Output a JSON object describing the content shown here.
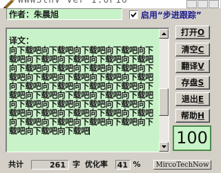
{
  "window": {
    "title": "WWWSlnV Ver 1.0F16",
    "app_icon": "pencil-cursor-icon"
  },
  "author": {
    "text": "作者：朱晨旭"
  },
  "step_trace": {
    "label": "启用“步进跟踪”",
    "checked": true
  },
  "content": {
    "heading": "译文：",
    "body": "向下载吧向下载吧向下载吧向下载吧向下载吧向下载吧向下载吧向下载吧向下载吧向下载吧向下载吧向下载吧向下载吧向下载吧向下载吧向下载吧向下载吧向下载吧向下载吧向下载吧向下载吧向下载吧向下载吧向下载吧向下载吧向下载吧向下载吧向下载吧向下载吧向下载吧向下载吧向下载吧向下载吧向下载吧向下载吧向下载吧向下载吧向下载吧向下载吧向下载吧向下载吧向下载吧向下载吧"
  },
  "buttons": [
    {
      "label": "打开",
      "key": "O"
    },
    {
      "label": "清空",
      "key": "C"
    },
    {
      "label": "翻译",
      "key": "V"
    },
    {
      "label": "存盘",
      "key": "S"
    },
    {
      "label": "退出",
      "key": "E"
    },
    {
      "label": "帮助",
      "key": "H"
    }
  ],
  "counter": {
    "value": "100"
  },
  "status": {
    "total_label": "共计",
    "total_value": "261",
    "total_unit": "字",
    "opt_label": "优化率",
    "opt_value": "41",
    "opt_unit": "%",
    "brand": "MircoTechNow"
  },
  "colors": {
    "panel_bg": "#c8f3c8",
    "window_bg": "#d4d0c8",
    "step_label": "#1a1a8a"
  }
}
